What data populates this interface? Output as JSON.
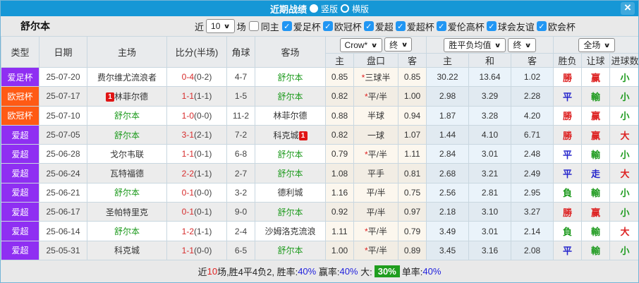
{
  "colors": {
    "accent_blue": "#1697d6",
    "purple": "#8f2ff2",
    "orange": "#ff5a14",
    "red": "#dd2222",
    "green": "#1d9a1d",
    "blue": "#2626cc",
    "check_blue": "#2196f3",
    "score_red": "#d62b2b",
    "summary_green": "#1f9e1f"
  },
  "titlebar": {
    "title": "近期战绩",
    "vertical_label": "竖版",
    "horizontal_label": "横版",
    "close_icon": "×"
  },
  "controls": {
    "team": "舒尔本",
    "recent_label": "近",
    "recent_value": "10",
    "matches_label": "场",
    "same_home_label": "同主",
    "cups": [
      "爱足杯",
      "欧冠杯",
      "爱超",
      "爱超杯",
      "爱伦高杯",
      "球会友谊",
      "欧会杯"
    ]
  },
  "dropdowns": {
    "bookmaker": "Crow*",
    "bookmaker_state": "终",
    "market": "胜平负均值",
    "market_state": "终",
    "scope": "全场"
  },
  "table": {
    "left_headers": [
      "类型",
      "日期",
      "主场",
      "比分(半场)",
      "角球",
      "客场"
    ],
    "sub_headers": [
      "主",
      "盘口",
      "客",
      "主",
      "和",
      "客",
      "胜负",
      "让球",
      "进球数"
    ],
    "rows": [
      {
        "league": "爱足杯",
        "league_color": "purple",
        "date": "25-07-20",
        "home": "费尔维尤流浪者",
        "home_team": false,
        "home_rank": "",
        "home_rank_pos": "",
        "away": "舒尔本",
        "away_team": true,
        "away_rank": "",
        "away_rank_pos": "",
        "score": "0-4",
        "half": "(0-2)",
        "corner": "4-7",
        "odds_home": "0.85",
        "handicap": "三球半",
        "handicap_star": true,
        "odds_away": "0.85",
        "avg_home": "30.22",
        "avg_draw": "13.64",
        "avg_away": "1.02",
        "result": "勝",
        "result_color": "red",
        "cover": "赢",
        "cover_color": "red",
        "goals": "小",
        "goals_color": "green"
      },
      {
        "league": "欧冠杯",
        "league_color": "orange",
        "date": "25-07-17",
        "home": "林菲尔德",
        "home_team": false,
        "home_rank": "1",
        "home_rank_pos": "before",
        "away": "舒尔本",
        "away_team": true,
        "away_rank": "",
        "away_rank_pos": "",
        "score": "1-1",
        "half": "(1-1)",
        "corner": "1-5",
        "odds_home": "0.82",
        "handicap": "平/半",
        "handicap_star": true,
        "odds_away": "1.00",
        "avg_home": "2.98",
        "avg_draw": "3.29",
        "avg_away": "2.28",
        "result": "平",
        "result_color": "blue",
        "cover": "輸",
        "cover_color": "green",
        "goals": "小",
        "goals_color": "green"
      },
      {
        "league": "欧冠杯",
        "league_color": "orange",
        "date": "25-07-10",
        "home": "舒尔本",
        "home_team": true,
        "home_rank": "",
        "home_rank_pos": "",
        "away": "林菲尔德",
        "away_team": false,
        "away_rank": "",
        "away_rank_pos": "",
        "score": "1-0",
        "half": "(0-0)",
        "corner": "11-2",
        "odds_home": "0.88",
        "handicap": "半球",
        "handicap_star": false,
        "odds_away": "0.94",
        "avg_home": "1.87",
        "avg_draw": "3.28",
        "avg_away": "4.20",
        "result": "勝",
        "result_color": "red",
        "cover": "赢",
        "cover_color": "red",
        "goals": "小",
        "goals_color": "green"
      },
      {
        "league": "爱超",
        "league_color": "purple",
        "date": "25-07-05",
        "home": "舒尔本",
        "home_team": true,
        "home_rank": "",
        "home_rank_pos": "",
        "away": "科克城",
        "away_team": false,
        "away_rank": "1",
        "away_rank_pos": "after",
        "score": "3-1",
        "half": "(2-1)",
        "corner": "7-2",
        "odds_home": "0.82",
        "handicap": "一球",
        "handicap_star": false,
        "odds_away": "1.07",
        "avg_home": "1.44",
        "avg_draw": "4.10",
        "avg_away": "6.71",
        "result": "勝",
        "result_color": "red",
        "cover": "赢",
        "cover_color": "red",
        "goals": "大",
        "goals_color": "red"
      },
      {
        "league": "爱超",
        "league_color": "purple",
        "date": "25-06-28",
        "home": "戈尔韦联",
        "home_team": false,
        "home_rank": "",
        "home_rank_pos": "",
        "away": "舒尔本",
        "away_team": true,
        "away_rank": "",
        "away_rank_pos": "",
        "score": "1-1",
        "half": "(0-1)",
        "corner": "6-8",
        "odds_home": "0.79",
        "handicap": "平/半",
        "handicap_star": true,
        "odds_away": "1.11",
        "avg_home": "2.84",
        "avg_draw": "3.01",
        "avg_away": "2.48",
        "result": "平",
        "result_color": "blue",
        "cover": "輸",
        "cover_color": "green",
        "goals": "小",
        "goals_color": "green"
      },
      {
        "league": "爱超",
        "league_color": "purple",
        "date": "25-06-24",
        "home": "瓦特福德",
        "home_team": false,
        "home_rank": "",
        "home_rank_pos": "",
        "away": "舒尔本",
        "away_team": true,
        "away_rank": "",
        "away_rank_pos": "",
        "score": "2-2",
        "half": "(1-1)",
        "corner": "2-7",
        "odds_home": "1.08",
        "handicap": "平手",
        "handicap_star": false,
        "odds_away": "0.81",
        "avg_home": "2.68",
        "avg_draw": "3.21",
        "avg_away": "2.49",
        "result": "平",
        "result_color": "blue",
        "cover": "走",
        "cover_color": "blue",
        "goals": "大",
        "goals_color": "red"
      },
      {
        "league": "爱超",
        "league_color": "purple",
        "date": "25-06-21",
        "home": "舒尔本",
        "home_team": true,
        "home_rank": "",
        "home_rank_pos": "",
        "away": "德利城",
        "away_team": false,
        "away_rank": "",
        "away_rank_pos": "",
        "score": "0-1",
        "half": "(0-0)",
        "corner": "3-2",
        "odds_home": "1.16",
        "handicap": "平/半",
        "handicap_star": false,
        "odds_away": "0.75",
        "avg_home": "2.56",
        "avg_draw": "2.81",
        "avg_away": "2.95",
        "result": "負",
        "result_color": "green",
        "cover": "輸",
        "cover_color": "green",
        "goals": "小",
        "goals_color": "green"
      },
      {
        "league": "爱超",
        "league_color": "purple",
        "date": "25-06-17",
        "home": "圣帕特里克",
        "home_team": false,
        "home_rank": "",
        "home_rank_pos": "",
        "away": "舒尔本",
        "away_team": true,
        "away_rank": "",
        "away_rank_pos": "",
        "score": "0-1",
        "half": "(0-1)",
        "corner": "9-0",
        "odds_home": "0.92",
        "handicap": "平/半",
        "handicap_star": false,
        "odds_away": "0.97",
        "avg_home": "2.18",
        "avg_draw": "3.10",
        "avg_away": "3.27",
        "result": "勝",
        "result_color": "red",
        "cover": "赢",
        "cover_color": "red",
        "goals": "小",
        "goals_color": "green"
      },
      {
        "league": "爱超",
        "league_color": "purple",
        "date": "25-06-14",
        "home": "舒尔本",
        "home_team": true,
        "home_rank": "",
        "home_rank_pos": "",
        "away": "沙姆洛克流浪",
        "away_team": false,
        "away_rank": "",
        "away_rank_pos": "",
        "score": "1-2",
        "half": "(1-1)",
        "corner": "2-4",
        "odds_home": "1.11",
        "handicap": "平/半",
        "handicap_star": true,
        "odds_away": "0.79",
        "avg_home": "3.49",
        "avg_draw": "3.01",
        "avg_away": "2.14",
        "result": "負",
        "result_color": "green",
        "cover": "輸",
        "cover_color": "green",
        "goals": "大",
        "goals_color": "red"
      },
      {
        "league": "爱超",
        "league_color": "purple",
        "date": "25-05-31",
        "home": "科克城",
        "home_team": false,
        "home_rank": "",
        "home_rank_pos": "",
        "away": "舒尔本",
        "away_team": true,
        "away_rank": "",
        "away_rank_pos": "",
        "score": "1-1",
        "half": "(0-0)",
        "corner": "6-5",
        "odds_home": "1.00",
        "handicap": "平/半",
        "handicap_star": true,
        "odds_away": "0.89",
        "avg_home": "3.45",
        "avg_draw": "3.16",
        "avg_away": "2.08",
        "result": "平",
        "result_color": "blue",
        "cover": "輸",
        "cover_color": "green",
        "goals": "小",
        "goals_color": "green"
      }
    ]
  },
  "summary": {
    "prefix": "近",
    "count": "10",
    "record_text": "场,胜4平4负2, 胜率:",
    "win_rate": "40%",
    "cover_label": " 赢率:",
    "cover_rate": "40%",
    "big_label": " 大:",
    "big_rate": "30%",
    "single_label": "单率:",
    "single_rate": "40%"
  }
}
